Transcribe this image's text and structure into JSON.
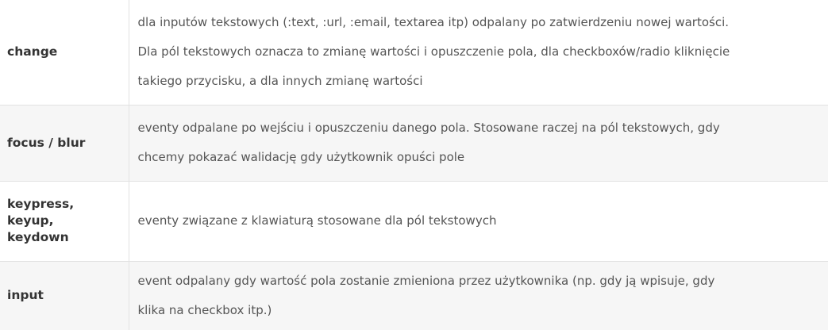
{
  "rows": [
    {
      "name_lines": [
        "change"
      ],
      "desc_lines": [
        "dla inputów tekstowych (:text, :url, :email, textarea itp) odpalany po zatwierdzeniu nowej wartości.",
        "Dla pól tekstowych oznacza to zmianę wartości i opuszczenie pola, dla checkboxów/radio kliknięcie",
        "takiego przycisku, a dla innych zmianę wartości"
      ]
    },
    {
      "name_lines": [
        "focus / blur"
      ],
      "desc_lines": [
        "eventy odpalane po wejściu i opuszczeniu danego pola. Stosowane raczej na pól tekstowych, gdy",
        "chcemy pokazać walidację gdy użytkownik opuści pole"
      ]
    },
    {
      "name_lines": [
        "keypress,",
        "keyup,",
        "keydown"
      ],
      "desc_lines": [
        "eventy związane z klawiaturą stosowane dla pól tekstowych"
      ]
    },
    {
      "name_lines": [
        "input"
      ],
      "desc_lines": [
        "event odpalany gdy wartość pola zostanie zmieniona przez użytkownika (np. gdy ją wpisuje, gdy",
        "klika na checkbox itp.)"
      ]
    }
  ]
}
